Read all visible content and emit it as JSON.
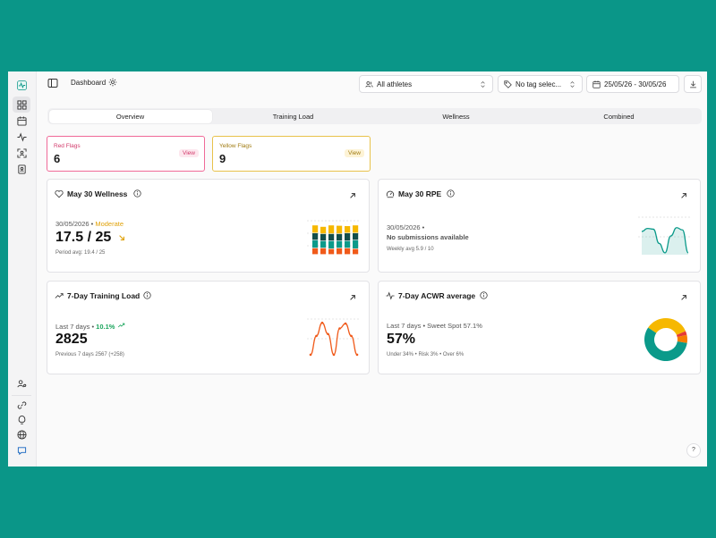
{
  "colors": {
    "teal": "#0a9688",
    "accent_green": "#1aa55c",
    "moderate": "#e0a20a",
    "orange": "#f05a1a",
    "red_flag": "#f06a98",
    "yellow_flag": "#e8c24b"
  },
  "sidebar": {
    "items": [
      {
        "icon": "dashboard-icon",
        "active": true
      },
      {
        "icon": "calendar-icon",
        "active": false
      },
      {
        "icon": "activity-icon",
        "active": false
      },
      {
        "icon": "scan-face-icon",
        "active": false
      },
      {
        "icon": "contact-book-icon",
        "active": false
      }
    ],
    "bottom_items": [
      {
        "icon": "user-settings-icon"
      },
      {
        "icon": "link-icon"
      },
      {
        "icon": "lightbulb-icon"
      },
      {
        "icon": "globe-icon"
      },
      {
        "icon": "chat-icon"
      }
    ]
  },
  "header": {
    "title": "Dashboard",
    "athletes_select": "All athletes",
    "tag_select": "No tag selec...",
    "date_range": "25/05/26 - 30/05/26"
  },
  "tabs": [
    {
      "label": "Overview",
      "active": true
    },
    {
      "label": "Training Load",
      "active": false
    },
    {
      "label": "Wellness",
      "active": false
    },
    {
      "label": "Combined",
      "active": false
    }
  ],
  "flags": {
    "red": {
      "label": "Red Flags",
      "value": "6",
      "view": "View"
    },
    "yellow": {
      "label": "Yellow Flags",
      "value": "9",
      "view": "View"
    }
  },
  "cards": {
    "wellness": {
      "title": "May 30 Wellness",
      "date": "30/05/2026 •",
      "status": "Moderate",
      "value": "17.5 / 25",
      "footer": "Period avg: 19.4 / 25",
      "bars": [
        [
          0.18,
          0.22,
          0.2,
          0.22
        ],
        [
          0.18,
          0.2,
          0.2,
          0.2
        ],
        [
          0.16,
          0.22,
          0.2,
          0.24
        ],
        [
          0.18,
          0.2,
          0.2,
          0.23
        ],
        [
          0.18,
          0.2,
          0.22,
          0.2
        ],
        [
          0.16,
          0.24,
          0.2,
          0.22
        ]
      ],
      "bar_colors": [
        "#f05a1a",
        "#0b9a8a",
        "#134e4a",
        "#f6b800"
      ]
    },
    "rpe": {
      "title": "May 30 RPE",
      "date": "30/05/2026 •",
      "status": "No submissions available",
      "footer": "Weekly avg 5.9 / 10",
      "series": [
        0.62,
        0.7,
        0.68,
        0.3,
        0.05,
        0.5,
        0.72,
        0.66,
        0.05
      ]
    },
    "training_load": {
      "title": "7-Day Training Load",
      "prefix": "Last 7 days •",
      "change": "10.1%",
      "value": "2825",
      "footer": "Previous 7 days 2567 (+258)",
      "series": [
        0.05,
        0.55,
        0.9,
        0.6,
        0.05,
        0.75,
        0.88,
        0.55,
        0.05
      ]
    },
    "acwr": {
      "title": "7-Day ACWR average",
      "prefix": "Last 7 days • Sweet Spot 57.1%",
      "value": "57%",
      "footer": "Under 34% • Risk 3% • Over 6%",
      "segments": [
        {
          "name": "Sweet Spot",
          "value": 57.1,
          "color": "#0b9a8a"
        },
        {
          "name": "Under",
          "value": 34,
          "color": "#f6b800"
        },
        {
          "name": "Risk",
          "value": 3,
          "color": "#e53935"
        },
        {
          "name": "Over",
          "value": 6,
          "color": "#f57c00"
        }
      ]
    }
  },
  "help": "?"
}
